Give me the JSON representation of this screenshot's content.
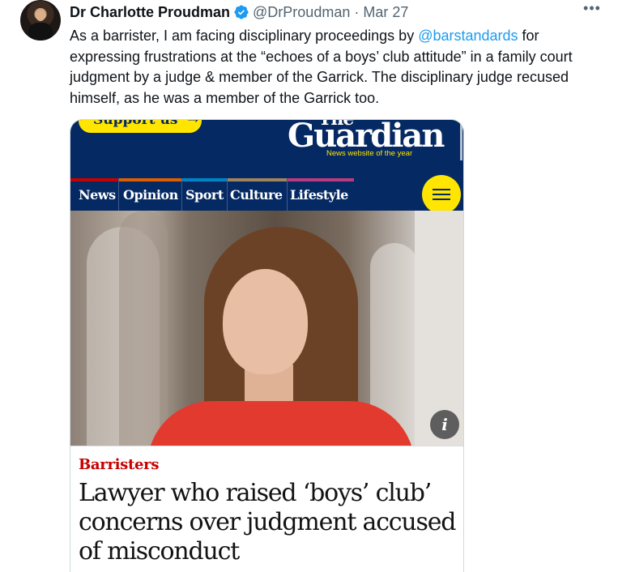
{
  "author": {
    "display_name": "Dr Charlotte Proudman",
    "handle": "@DrProudman",
    "separator": "·",
    "date": "Mar 27",
    "verified_color": "#1d9bf0"
  },
  "more_label": "•••",
  "tweet": {
    "text_part1": "As a barrister, I am facing disciplinary proceedings by ",
    "mention": "@barstandards",
    "text_part2": " for expressing frustrations at the “echoes of a boys’ club attitude” in a family court judgment by a judge & member of the Garrick. The disciplinary judge recused himself, as he was a member of the Garrick too."
  },
  "media": {
    "support_label": "Support us",
    "support_arrow": "→",
    "masthead_top": "The",
    "logo": "Guardian",
    "tagline": "News website of the year",
    "nav": [
      {
        "label": "News",
        "color": "#c70000"
      },
      {
        "label": "Opinion",
        "color": "#e05e00"
      },
      {
        "label": "Sport",
        "color": "#0084c6"
      },
      {
        "label": "Culture",
        "color": "#a1845c"
      },
      {
        "label": "Lifestyle",
        "color": "#bb3b80"
      }
    ],
    "info_label": "i",
    "kicker": "Barristers",
    "headline": "Lawyer who raised ‘boys’ club’ concerns over judgment accused of misconduct",
    "brand_color": "#052962",
    "accent_color": "#ffe500"
  }
}
